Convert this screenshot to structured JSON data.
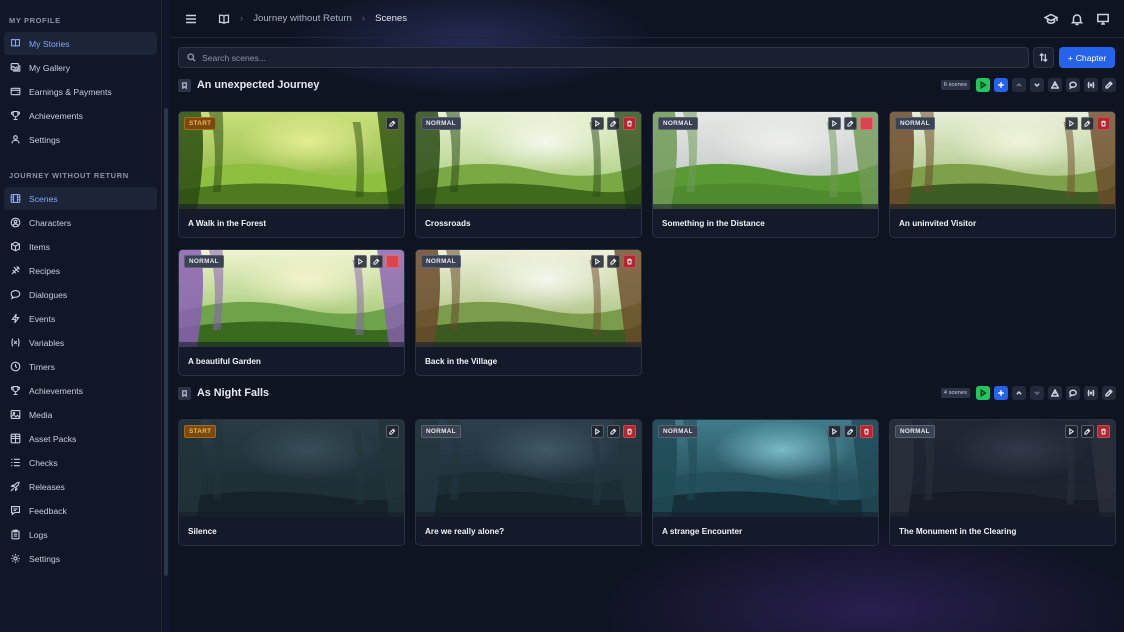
{
  "sidebar": {
    "profile_heading": "MY PROFILE",
    "profile_items": [
      {
        "label": "My Stories",
        "icon": "book-icon",
        "active": true
      },
      {
        "label": "My Gallery",
        "icon": "gallery-icon"
      },
      {
        "label": "Earnings & Payments",
        "icon": "wallet-icon"
      },
      {
        "label": "Achievements",
        "icon": "trophy-icon"
      },
      {
        "label": "Settings",
        "icon": "user-icon"
      }
    ],
    "story_heading": "JOURNEY WITHOUT RETURN",
    "story_items": [
      {
        "label": "Scenes",
        "icon": "scenes-icon",
        "active": true
      },
      {
        "label": "Characters",
        "icon": "character-icon"
      },
      {
        "label": "Items",
        "icon": "box-icon"
      },
      {
        "label": "Recipes",
        "icon": "flask-icon"
      },
      {
        "label": "Dialogues",
        "icon": "speech-bubble-icon"
      },
      {
        "label": "Events",
        "icon": "lightning-icon"
      },
      {
        "label": "Variables",
        "icon": "variable-icon"
      },
      {
        "label": "Timers",
        "icon": "clock-icon"
      },
      {
        "label": "Achievements",
        "icon": "trophy-icon"
      },
      {
        "label": "Media",
        "icon": "image-icon"
      },
      {
        "label": "Asset Packs",
        "icon": "grid-icon"
      },
      {
        "label": "Checks",
        "icon": "checklist-icon"
      },
      {
        "label": "Releases",
        "icon": "rocket-icon"
      },
      {
        "label": "Feedback",
        "icon": "feedback-icon"
      },
      {
        "label": "Logs",
        "icon": "clipboard-icon"
      },
      {
        "label": "Settings",
        "icon": "gear-icon"
      }
    ]
  },
  "topbar": {
    "breadcrumb": [
      "Journey without Return",
      "Scenes"
    ]
  },
  "toolbar": {
    "search_placeholder": "Search scenes...",
    "chapter_button": "Chapter"
  },
  "chapters": [
    {
      "title": "An unexpected Journey",
      "count_label": "6 scenes",
      "scenes": [
        {
          "title": "A Walk in the Forest",
          "type": "START",
          "theme": "forest-day",
          "actions": [
            "edit"
          ]
        },
        {
          "title": "Crossroads",
          "type": "NORMAL",
          "theme": "forest-light",
          "actions": [
            "play",
            "edit",
            "delete"
          ]
        },
        {
          "title": "Something in the Distance",
          "type": "NORMAL",
          "theme": "hills-cloudy",
          "actions": [
            "play",
            "edit",
            "delete-solid"
          ]
        },
        {
          "title": "An uninvited Visitor",
          "type": "NORMAL",
          "theme": "cottage-day",
          "actions": [
            "play",
            "edit",
            "delete"
          ]
        },
        {
          "title": "A beautiful Garden",
          "type": "NORMAL",
          "theme": "garden",
          "actions": [
            "play",
            "edit",
            "delete-solid"
          ]
        },
        {
          "title": "Back in the Village",
          "type": "NORMAL",
          "theme": "cottage-day2",
          "actions": [
            "play",
            "edit",
            "delete"
          ]
        }
      ]
    },
    {
      "title": "As Night Falls",
      "count_label": "4 scenes",
      "scenes": [
        {
          "title": "Silence",
          "type": "START",
          "theme": "cottage-night",
          "actions": [
            "edit"
          ]
        },
        {
          "title": "Are we really alone?",
          "type": "NORMAL",
          "theme": "fence-night",
          "actions": [
            "play",
            "edit",
            "delete"
          ]
        },
        {
          "title": "A strange Encounter",
          "type": "NORMAL",
          "theme": "forest-night-blue",
          "actions": [
            "play",
            "edit",
            "delete"
          ]
        },
        {
          "title": "The Monument in the Clearing",
          "type": "NORMAL",
          "theme": "monument-night",
          "actions": [
            "play",
            "edit",
            "delete"
          ]
        }
      ]
    }
  ],
  "colors": {
    "accent": "#2563eb",
    "play_green": "#22c55e",
    "start_badge": "#f5b352",
    "delete_red": "#b3262e"
  }
}
